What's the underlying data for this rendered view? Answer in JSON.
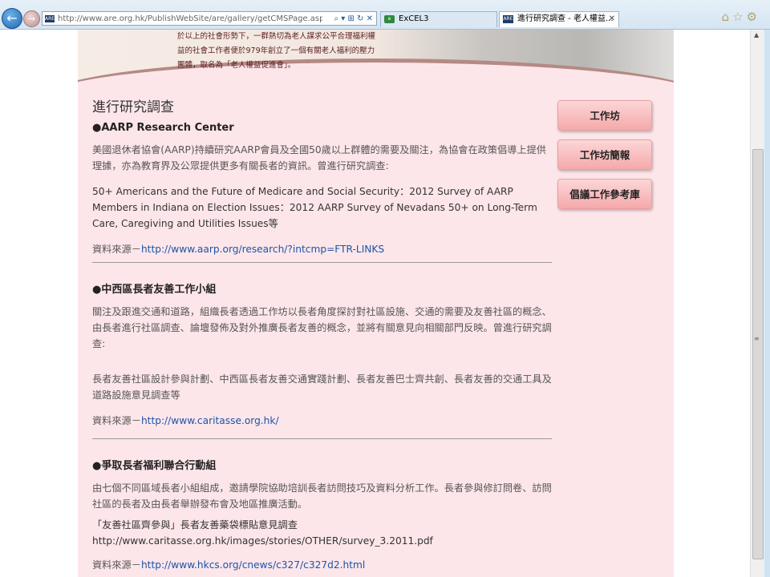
{
  "browser": {
    "url": "http://www.are.org.hk/PublishWebSite/are/gallery/getCMSPage.asp?url=/F",
    "address_controls": "⌕ ▾ ⊞ ↻ ✕",
    "tabs": [
      {
        "label": "ExCEL3",
        "icon": "excel-icon"
      },
      {
        "label": "進行研究調查 - 老人權益...",
        "icon": "site-icon"
      }
    ],
    "site_icon_text": "ARE"
  },
  "banner": {
    "lines": [
      "於以上的社會形勢下，一群熱切為老人謀求公平合理福利權",
      "益的社會工作者便於979年創立了一個有關老人福利的壓力",
      "團體，取名為「老人權益促進會」。"
    ]
  },
  "main": {
    "heading": "進行研究調查",
    "sections": [
      {
        "title": "●AARP Research Center",
        "para1": "美國退休者協會(AARP)持續研究AARP會員及全國50歲以上群體的需要及關注，為協會在政策倡導上提供理據，亦為教育界及公眾提供更多有關長者的資訊。曾進行研究調查:",
        "para2": "50+ Americans and the Future of Medicare and Social Security：2012 Survey of AARP Members in Indiana on Election Issues：2012 AARP Survey of Nevadans 50+ on Long-Term Care, Caregiving and Utilities Issues等",
        "source_label": "資料來源－",
        "source_link": "http://www.aarp.org/research/?intcmp=FTR-LINKS"
      },
      {
        "title": "●中西區長者友善工作小組",
        "para1": "關注及跟進交通和道路，組織長者透過工作坊以長者角度探討對社區設施、交通的需要及友善社區的概念、由長者進行社區調查、論壇發佈及對外推廣長者友善的概念，並將有關意見向相關部門反映。曾進行研究調查:",
        "para2": "長者友善社區設計參與計劃、中西區長者友善交通實踐計劃、長者友善巴士齊共創、長者友善的交通工具及道路設施意見調查等",
        "source_label": "資料來源－",
        "source_link": "http://www.caritasse.org.hk/"
      },
      {
        "title": "●爭取長者福利聯合行動組",
        "para1": "由七個不同區域長者小組組成，邀請學院協助培訓長者訪問技巧及資料分析工作。長者參與修訂問卷、訪問社區的長者及由長者舉辦發布會及地區推廣活動。",
        "para2a": "「友善社區齊參與」長者友善藥袋標貼意見調查",
        "para2b": "http://www.caritasse.org.hk/images/stories/OTHER/survey_3.2011.pdf",
        "source_label": "資料來源－",
        "source_link": "http://www.hkcs.org/cnews/c327/c327d2.html"
      }
    ]
  },
  "sidebar": {
    "buttons": [
      "工作坊",
      "工作坊簡報",
      "倡議工作參考庫"
    ]
  }
}
